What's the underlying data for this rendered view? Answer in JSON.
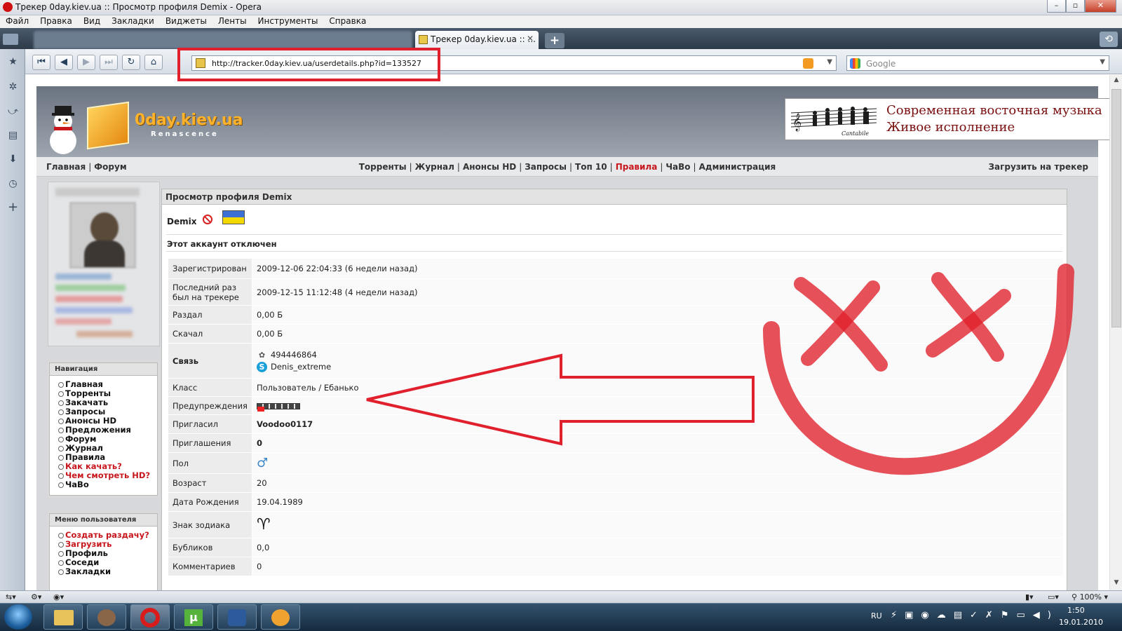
{
  "window": {
    "title": "Трекер 0day.kiev.ua :: Просмотр профиля Demix - Opera"
  },
  "menu": [
    "Файл",
    "Правка",
    "Вид",
    "Закладки",
    "Виджеты",
    "Ленты",
    "Инструменты",
    "Справка"
  ],
  "tabs": {
    "active_label": "Трекер 0day.kiev.ua :: ..."
  },
  "address": {
    "url": "http://tracker.0day.kiev.ua/userdetails.php?id=133527"
  },
  "search": {
    "placeholder": "Google"
  },
  "site": {
    "logo_name": "0day.kiev.ua",
    "logo_sub": "Renascence",
    "banner_line1": "Современная восточная музыка",
    "banner_line2": "Живое исполнение",
    "banner_brand": "Cantabile",
    "nav_left": [
      "Главная",
      "Форум"
    ],
    "nav_mid": [
      "Торренты",
      "Журнал",
      "Анонсы HD",
      "Запросы",
      "Топ 10",
      "Правила",
      "ЧаВо",
      "Администрация"
    ],
    "nav_mid_highlight": "Правила",
    "nav_right": "Загрузить на трекер"
  },
  "sidebar": {
    "nav_title": "Навигация",
    "nav_items": [
      {
        "label": "Главная",
        "highlight": false
      },
      {
        "label": "Торренты",
        "highlight": false
      },
      {
        "label": "Закачать",
        "highlight": false
      },
      {
        "label": "Запросы",
        "highlight": false
      },
      {
        "label": "Анонсы HD",
        "highlight": false
      },
      {
        "label": "Предложения",
        "highlight": false
      },
      {
        "label": "Форум",
        "highlight": false
      },
      {
        "label": "Журнал",
        "highlight": false
      },
      {
        "label": "Правила",
        "highlight": false
      },
      {
        "label": "Как качать?",
        "highlight": true
      },
      {
        "label": "Чем смотреть HD?",
        "highlight": true
      },
      {
        "label": "ЧаВо",
        "highlight": false
      }
    ],
    "user_title": "Меню пользователя",
    "user_items": [
      {
        "label": "Создать раздачу?",
        "highlight": true
      },
      {
        "label": "Загрузить",
        "highlight": true
      },
      {
        "label": "Профиль",
        "highlight": false
      },
      {
        "label": "Соседи",
        "highlight": false
      },
      {
        "label": "Закладки",
        "highlight": false
      }
    ]
  },
  "profile": {
    "title": "Просмотр профиля Demix",
    "username": "Demix",
    "disabled_text": "Этот аккаунт отключен",
    "rows": [
      {
        "label": "Зарегистрирован",
        "value": "2009-12-06 22:04:33 (6 недели назад)"
      },
      {
        "label": "Последний раз был на трекере",
        "value": "2009-12-15 11:12:48 (4 недели назад)"
      },
      {
        "label": "Раздал",
        "value": "0,00 Б"
      },
      {
        "label": "Скачал",
        "value": "0,00 Б"
      },
      {
        "label": "Связь",
        "value": "",
        "contacts": [
          "494446864",
          "Denis_extreme"
        ]
      },
      {
        "label": "Класс",
        "value": "Пользователь / Ебанько"
      },
      {
        "label": "Предупреждения",
        "value": "",
        "warnings": "bar"
      },
      {
        "label": "Пригласил",
        "value": "Voodoo0117",
        "bold": true
      },
      {
        "label": "Приглашения",
        "value": "0",
        "bold": true
      },
      {
        "label": "Пол",
        "value": "",
        "icon": "male-icon"
      },
      {
        "label": "Возраст",
        "value": "20"
      },
      {
        "label": "Дата Рождения",
        "value": "19.04.1989"
      },
      {
        "label": "Знак зодиака",
        "value": "",
        "icon": "aries-icon"
      },
      {
        "label": "Бубликов",
        "value": "0,0"
      },
      {
        "label": "Комментариев",
        "value": "0"
      }
    ]
  },
  "statusbar": {
    "zoom": "100%"
  },
  "taskbar": {
    "lang": "RU",
    "time": "1:50",
    "date": "19.01.2010"
  },
  "annotation": {
    "color": "#e0202c"
  }
}
